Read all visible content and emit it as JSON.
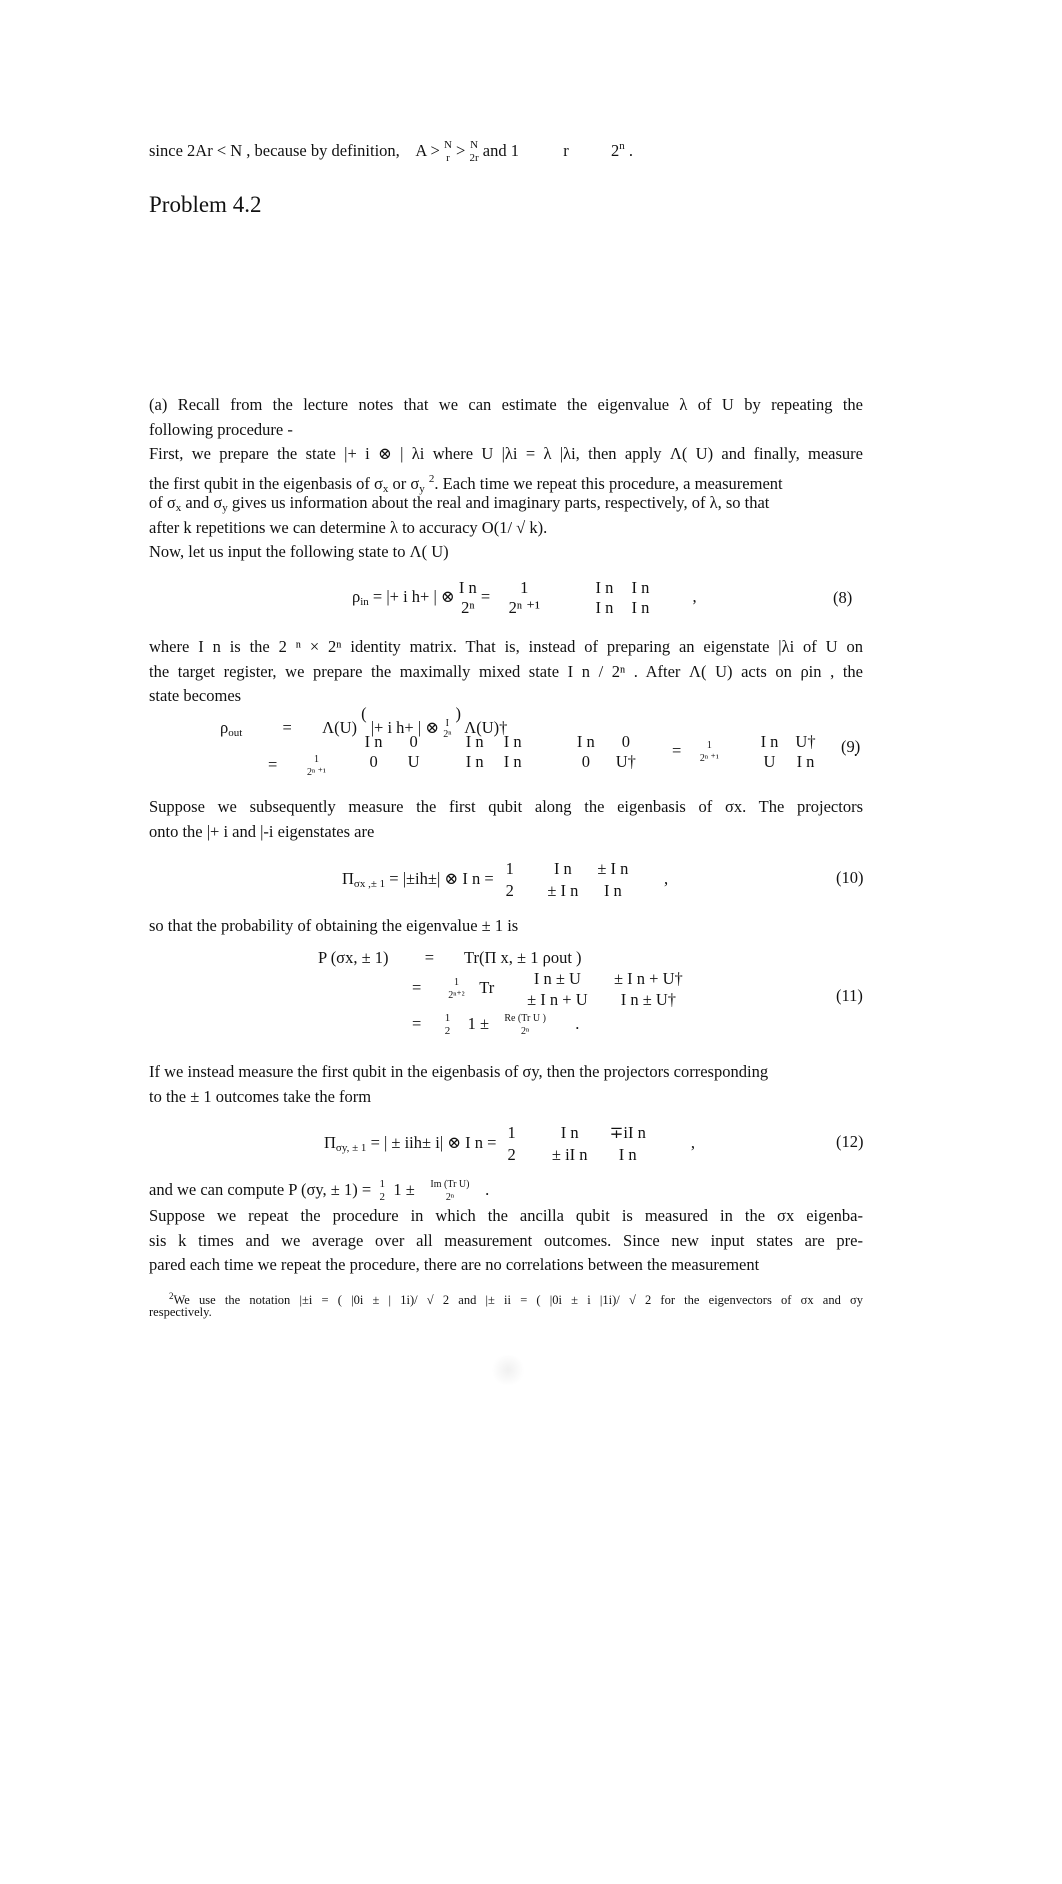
{
  "intro_line": {
    "p1": "since 2Ar < N  , because by definition,",
    "a_gt": "A >",
    "frac1_num": "N",
    "frac1_den": "r",
    "gt": ">",
    "frac2_num": "N",
    "frac2_den": "2r",
    "p2": "and 1",
    "r": "r",
    "two": "2",
    "n": "n",
    "period": "."
  },
  "heading": "Problem 4.2",
  "part_a": {
    "line1": "(a) Recall from the lecture notes that we can estimate the eigenvalue        λ of U by repeating the",
    "line2": "following procedure -",
    "line3": "First, we prepare the state    |+ i ⊗ | λi  where  U |λi  =  λ |λi, then apply Λ(  U) and finally, measure",
    "line4_a": "the first qubit in the eigenbasis of    σ",
    "line4_x": "x",
    "line4_b": " or σ",
    "line4_y": "y",
    "line4_fn": "2",
    "line4_c": ". Each time we repeat this procedure, a measurement",
    "line5_a": "of σ",
    "line5_x": "x",
    "line5_b": " and  σ",
    "line5_y": "y",
    "line5_c": " gives us information about the real and imaginary parts, respectively, of          λ, so that",
    "line6": "after  k repetitions we can determine    λ  to accuracy  O(1/ √ k).",
    "line7": "Now, let us input the following state to Λ(    U)"
  },
  "eq8": {
    "lhs": "ρ",
    "lhs_sub": "in",
    "mid": " =  |+ i h+ | ⊗ ",
    "frac_num": "I n",
    "frac_den": "2ⁿ",
    "eq": " = ",
    "coef_num": "1",
    "coef_den": "2ⁿ ⁺¹",
    "matrix": [
      [
        "I n",
        "I n"
      ],
      [
        "I n",
        "I n"
      ]
    ],
    "comma": ",",
    "number": "(8)"
  },
  "para_where": {
    "line1": "where  I n  is the 2 ⁿ × 2ⁿ  identity matrix. That is, instead of preparing an eigenstate        |λi  of U  on",
    "line2": "the target register, we prepare the maximally mixed state       I n / 2ⁿ . After  Λ( U) acts on  ρin , the",
    "line3": "state becomes"
  },
  "eq9": {
    "lhs": "ρ",
    "lhs_sub": "out",
    "eq": "=",
    "row1": "Λ(U) ( |+ i h+ | ⊗ I/2ⁿ ) Λ(U)†",
    "row1_a": "Λ(U)",
    "row1_b": "|+ i h+ | ⊗",
    "row1_frac_num": "I",
    "row1_frac_den": "2ⁿ",
    "row1_c": "Λ(U)†",
    "coef_num": "1",
    "coef_den": "2ⁿ ⁺¹",
    "m1": [
      [
        "I n",
        "0"
      ],
      [
        "0",
        "U"
      ]
    ],
    "m2": [
      [
        "I n",
        "I n"
      ],
      [
        "I n",
        "I n"
      ]
    ],
    "m3": [
      [
        "I n",
        "0"
      ],
      [
        "0",
        "U†"
      ]
    ],
    "m4": [
      [
        "I n",
        "U†"
      ],
      [
        "U",
        "I n"
      ]
    ],
    "period": ".",
    "number": "(9)"
  },
  "para_suppose": {
    "line1": "Suppose we subsequently measure the first qubit along the eigenbasis of        σx.  The projectors",
    "line2": "onto the  |+ i  and  |-i   eigenstates are"
  },
  "eq10": {
    "lhs": "Π",
    "lhs_sub": "σx ,± 1",
    "mid": " =  |±ih±| ⊗   I n  = ",
    "coef_num": "1",
    "coef_den": "2",
    "matrix": [
      [
        "I n",
        "± I n"
      ],
      [
        "± I n",
        "I n"
      ]
    ],
    "comma": ",",
    "number": "(10)"
  },
  "para_prob": "so that the probability of obtaining the eigenvalue       ± 1 is",
  "eq11": {
    "lhs": "P (σx, ± 1)",
    "eq": "=",
    "row1": "Tr(Π  x, ± 1 ρout )",
    "coef_num": "1",
    "coef_den": "2ⁿ⁺²",
    "tr": "Tr",
    "matrix": [
      [
        "I n ± U",
        "± I n + U†"
      ],
      [
        "± I n + U",
        "I n ± U†"
      ]
    ],
    "row3_half_num": "1",
    "row3_half_den": "2",
    "row3_a": "1 ±",
    "row3_frac_num": "Re (Tr  U )",
    "row3_frac_den": "2ⁿ",
    "row3_end": ".",
    "number": "(11)"
  },
  "para_instead": {
    "line1": "If we instead measure the first qubit in the eigenbasis of      σy, then the projectors corresponding",
    "line2": "to the  ± 1 outcomes take the form"
  },
  "eq12": {
    "lhs": "Π",
    "lhs_sub": "σy, ± 1",
    "mid": " =  | ±  iih± i| ⊗ I n  = ",
    "coef_num": "1",
    "coef_den": "2",
    "matrix": [
      [
        "I n",
        "∓iI n"
      ],
      [
        "± iI n",
        "I n"
      ]
    ],
    "comma": ",",
    "number": "(12)"
  },
  "para_compute": {
    "a": "and we can compute   P (σy, ± 1) = ",
    "half_num": "1",
    "half_den": "2",
    "b": " 1 ± ",
    "frac_num": "Im  (Tr  U)",
    "frac_den": "2ⁿ",
    "end": "  ."
  },
  "para_repeat": {
    "line1": "Suppose we repeat the procedure in which the ancilla qubit is measured in the        σx  eigenba-",
    "line2": "sis  k  times and we average over all measurement outcomes.       Since new input states are pre-",
    "line3": "pared each time we repeat the procedure, there are no correlations between the measurement"
  },
  "footnote": {
    "marker": "2",
    "line1": "We use the notation     |±i   = ( |0i ± |  1i)/ √ 2  and  |± ii  = ( |0i ±  i |1i)/ √ 2  for the eigenvectors of    σx  and  σy",
    "line2": "respectively."
  }
}
